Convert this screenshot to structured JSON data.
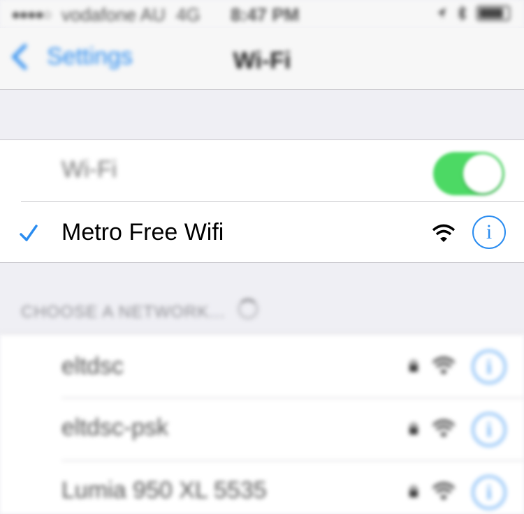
{
  "status_bar": {
    "signal": "●●●●○",
    "carrier": "vodafone AU",
    "network": "4G",
    "time": "8:47 PM"
  },
  "nav": {
    "back_label": "Settings",
    "title": "Wi-Fi"
  },
  "wifi_toggle": {
    "label": "Wi-Fi",
    "enabled": true
  },
  "connected_network": {
    "name": "Metro Free Wifi",
    "selected": true,
    "secured": false
  },
  "choose_section": {
    "header": "CHOOSE A NETWORK...",
    "networks": [
      {
        "name": "eltdsc",
        "secured": true
      },
      {
        "name": "eltdsc-psk",
        "secured": true
      },
      {
        "name": "Lumia 950 XL 5535",
        "secured": true
      }
    ]
  },
  "colors": {
    "accent": "#2a8cf0",
    "toggle_on": "#4cd964",
    "background": "#efeff4"
  },
  "icons": {
    "check": "checkmark-icon",
    "wifi": "wifi-signal-icon",
    "info": "info-icon",
    "lock": "lock-icon",
    "back": "chevron-left-icon"
  }
}
